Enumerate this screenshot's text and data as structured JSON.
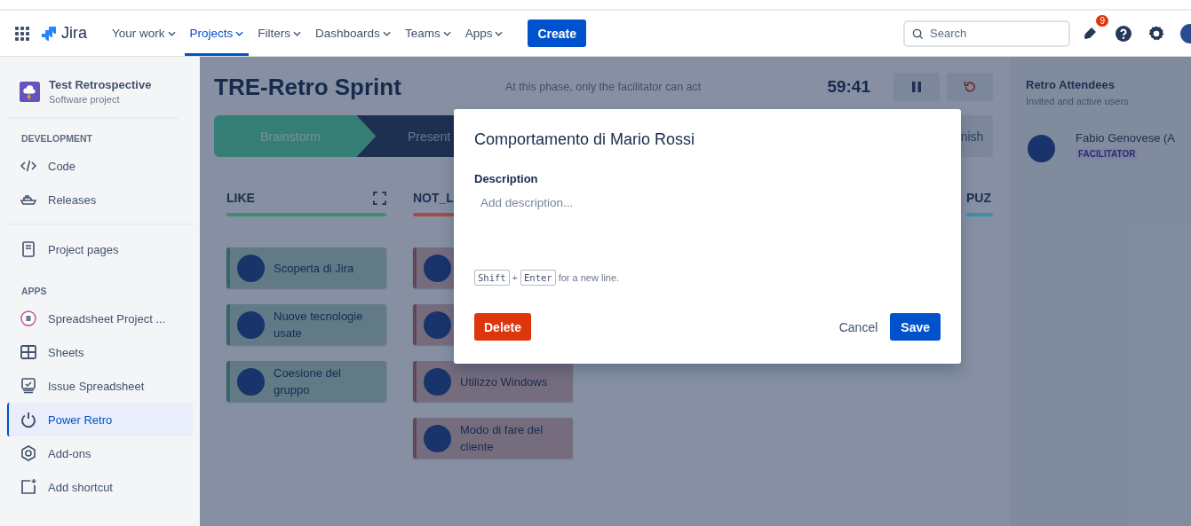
{
  "topnav": {
    "logo": "Jira",
    "items": [
      {
        "label": "Your work",
        "selected": false
      },
      {
        "label": "Projects",
        "selected": true
      },
      {
        "label": "Filters",
        "selected": false
      },
      {
        "label": "Dashboards",
        "selected": false
      },
      {
        "label": "Teams",
        "selected": false
      },
      {
        "label": "Apps",
        "selected": false
      }
    ],
    "create": "Create",
    "search": {
      "placeholder": "Search"
    },
    "notifications": "9"
  },
  "sidebar": {
    "project": {
      "name": "Test Retrospective",
      "type": "Software project"
    },
    "sections": [
      {
        "heading": "DEVELOPMENT",
        "items": [
          {
            "label": "Code",
            "kind": "code",
            "selected": false
          },
          {
            "label": "Releases",
            "kind": "ship",
            "selected": false
          }
        ]
      },
      {
        "items": [
          {
            "label": "Project pages",
            "kind": "page",
            "selected": false
          }
        ]
      },
      {
        "heading": "APPS",
        "items": [
          {
            "label": "Spreadsheet Project ...",
            "kind": "app",
            "selected": false
          },
          {
            "label": "Sheets",
            "kind": "table",
            "selected": false
          },
          {
            "label": "Issue Spreadsheet",
            "kind": "monitor",
            "selected": false
          },
          {
            "label": "Power Retro",
            "kind": "power",
            "selected": true
          },
          {
            "label": "Add-ons",
            "kind": "hexagon",
            "selected": false
          },
          {
            "label": "Add shortcut",
            "kind": "shortcut",
            "selected": false
          }
        ]
      }
    ]
  },
  "board": {
    "title": "TRE-Retro Sprint",
    "phase_note": "At this phase, only the facilitator can act",
    "timer": "59:41",
    "phases": [
      {
        "label": "Brainstorm",
        "kind": "done"
      },
      {
        "label": "Present",
        "kind": "current"
      },
      {
        "label": "nish",
        "kind": "upcoming"
      }
    ],
    "columns": [
      {
        "title": "LIKE",
        "color": "#3d8f6f",
        "expandable": true,
        "cards": [
          {
            "avatar": true,
            "text": "Scoperta di Jira"
          },
          {
            "avatar": true,
            "text": "Nuove tecnologie usate"
          },
          {
            "avatar": true,
            "text": "Coesione del gruppo"
          }
        ]
      },
      {
        "title": "NOT_L",
        "color": "#a64b45",
        "expandable": false,
        "cards": [
          {
            "avatar": true
          },
          {
            "avatar": true
          },
          {
            "avatar": true,
            "text": "Utilizzo Windows"
          },
          {
            "avatar": true,
            "text": "Modo di fare del cliente"
          }
        ]
      },
      {
        "title": "PUZ",
        "color": "#3d8fa5",
        "expandable": false
      }
    ]
  },
  "attendees": {
    "title": "Retro Attendees",
    "subtitle": "Invited and active users",
    "people": [
      {
        "name": "Fabio Genovese (A",
        "role": "FACILITATOR"
      }
    ]
  },
  "modal": {
    "title": "Comportamento di Mario Rossi",
    "field_label": "Description",
    "placeholder": "Add description...",
    "keys": [
      "Shift",
      "Enter"
    ],
    "key_joiner": "+",
    "hint": "for a new line.",
    "delete": "Delete",
    "cancel": "Cancel",
    "save": "Save"
  }
}
